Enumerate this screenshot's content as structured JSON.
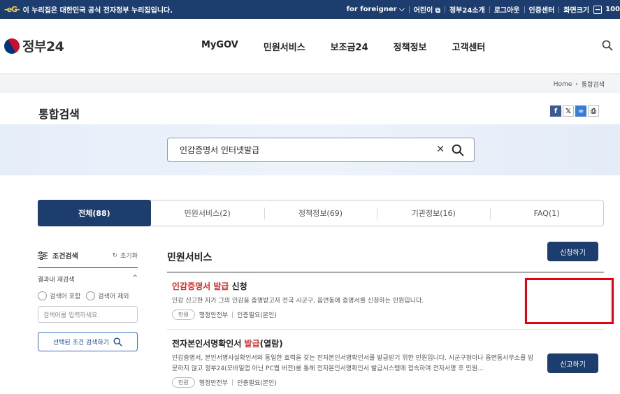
{
  "gov_bar": {
    "logo_mark": "-eG-",
    "notice": "이 누리집은 대한민국 공식 전자정부 누리집입니다.",
    "links": [
      "for foreigner",
      "어린이",
      "정부24소개",
      "로그아웃",
      "인증센터",
      "화면크기"
    ],
    "zoom": "100"
  },
  "header": {
    "logo": "정부24",
    "nav": [
      "MyGOV",
      "민원서비스",
      "보조금24",
      "정책정보",
      "고객센터"
    ]
  },
  "breadcrumb": {
    "home": "Home",
    "current": "통합검색"
  },
  "page": {
    "title": "통합검색"
  },
  "search": {
    "value": "인감증명서 인터넷발급"
  },
  "tabs": [
    "전체(88)",
    "민원서비스(2)",
    "정책정보(69)",
    "기관정보(16)",
    "FAQ(1)"
  ],
  "sidebar": {
    "filter_label": "조건검색",
    "reset_label": "초기화",
    "re_search_label": "결과내 재검색",
    "include_label": "검색어 포함",
    "exclude_label": "검색어 제외",
    "input_placeholder": "검색어를 입력하세요.",
    "search_button": "선택된 조건 검색하기"
  },
  "results": {
    "section_title": "민원서비스",
    "items": [
      {
        "title_hl": "인감증명서 발급",
        "title_rest": " 신청",
        "desc": "인감 신고한 자가 그의 인감을 증명받고자 전국 시군구, 읍면동에 증명서를 신청하는 민원입니다.",
        "badge": "민원",
        "agency": "행정안전부",
        "auth": "인증필요(본인)",
        "button": "신청하기"
      },
      {
        "title_pre": "전자본인서명확인서 ",
        "title_hl": "발급",
        "title_rest": "(열람)",
        "desc": "인감증명서, 본인서명사실확인서와 동일한 효력을 갖는 전자본인서명확인서를 발급받기 위한 민원입니다. 시군구청이나 읍면동사무소를 방문하지 않고 정부24(모바일앱 아닌 PC웹 버전)를 통해 전자본인서명확인서 발급시스템에 접속하여 전자서명 후 민원…",
        "badge": "민원",
        "agency": "행정안전부",
        "auth": "인증필요(본인)",
        "button": "신고하기"
      }
    ]
  },
  "colors": {
    "navy": "#1c3d6e",
    "highlight_red": "#d32f2f",
    "frame_red": "#e60012"
  }
}
